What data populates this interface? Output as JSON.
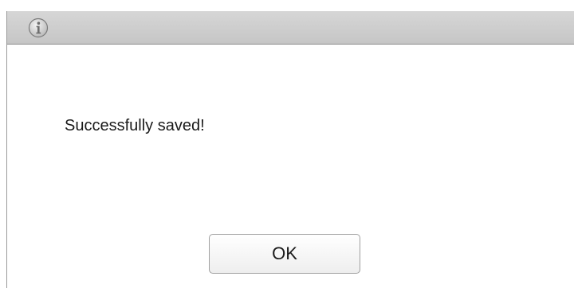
{
  "dialog": {
    "title_icon": "info-icon",
    "message": "Successfully saved!",
    "ok_label": "OK"
  },
  "colors": {
    "titlebar": "#cccccc",
    "border": "#8c8c8c",
    "text": "#1a1a1a"
  }
}
